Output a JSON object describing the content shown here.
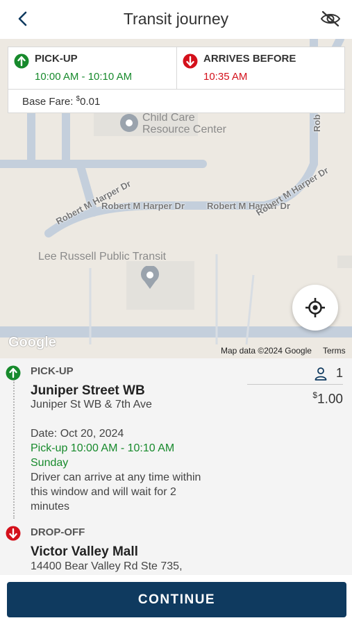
{
  "header": {
    "title": "Transit journey"
  },
  "map": {
    "poi": [
      {
        "label_line1": "Child Care",
        "label_line2": "Resource Center"
      },
      {
        "label": "Lee Russell Public Transit"
      }
    ],
    "roads": {
      "robert_harper_1": "Robert M Harper Dr",
      "robert_harper_2": "Robert M Harper Dr",
      "robert_harper_3": "Robert M Harper Dr",
      "robert_harper_4": "Robert M Harper Dr",
      "edge_label": "Rob"
    },
    "logo": "Google",
    "attribution": "Map data ©2024 Google",
    "terms": "Terms"
  },
  "trip_summary": {
    "pickup_label": "PICK-UP",
    "pickup_window": "10:00 AM - 10:10 AM",
    "arrives_label": "ARRIVES BEFORE",
    "arrives_time": "10:35 AM",
    "base_fare_label": "Base Fare: ",
    "base_fare_currency": "$",
    "base_fare_amount": "0.01"
  },
  "pickup": {
    "type": "PICK-UP",
    "name": "Juniper Street WB",
    "address": "Juniper St WB & 7th Ave",
    "date": "Date: Oct 20, 2024",
    "window": "Pick-up 10:00 AM - 10:10 AM",
    "day": "Sunday",
    "note_line1": "Driver can arrive at any time within",
    "note_line2": "this window and will wait for 2",
    "note_line3": "minutes"
  },
  "dropoff": {
    "type": "DROP-OFF",
    "name": "Victor Valley Mall",
    "address": "14400 Bear Valley Rd Ste 735,"
  },
  "fare": {
    "passengers": "1",
    "currency": "$",
    "amount": "1.00"
  },
  "footer": {
    "continue_label": "CONTINUE"
  },
  "colors": {
    "primary": "#0f3a5f",
    "pickup_green": "#178a2c",
    "dropoff_red": "#d4101b"
  }
}
